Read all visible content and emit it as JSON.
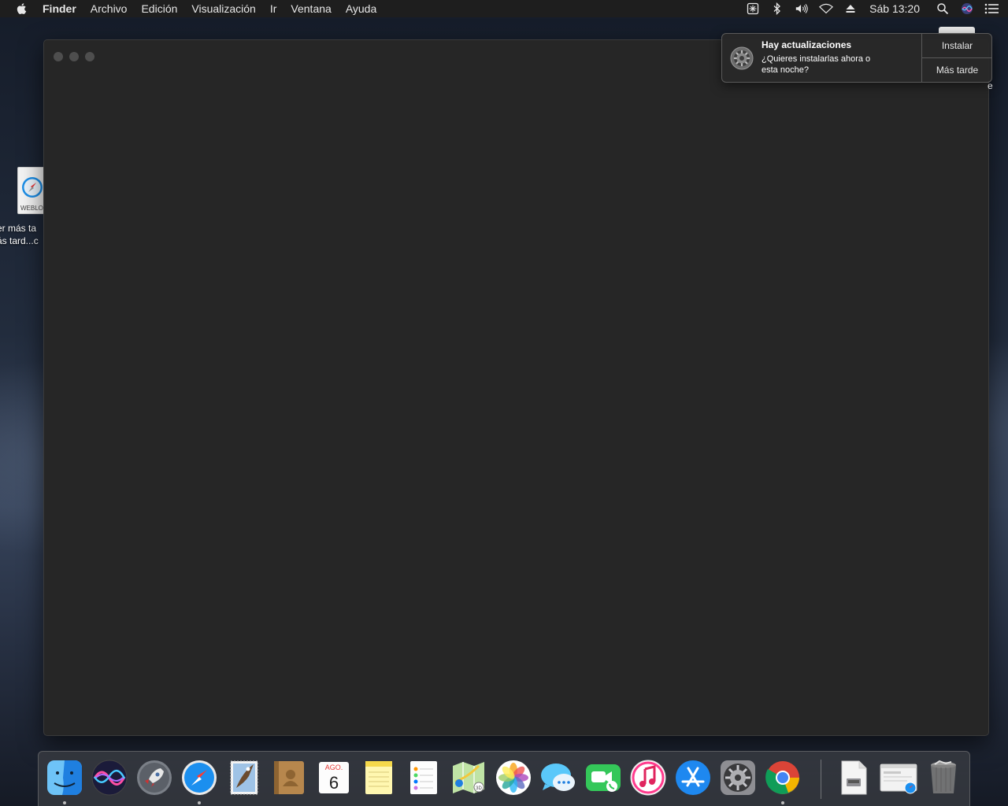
{
  "menubar": {
    "app_name": "Finder",
    "menus": [
      "Archivo",
      "Edición",
      "Visualización",
      "Ir",
      "Ventana",
      "Ayuda"
    ],
    "status_icons": [
      "screen-capture-icon",
      "bluetooth-icon",
      "volume-icon",
      "wifi-icon",
      "eject-icon"
    ],
    "clock": "Sáb 13:20"
  },
  "desktop": {
    "file_tag": "WEBLO",
    "file_label_line1": "er más ta",
    "file_label_line2": "ás tard...c"
  },
  "notification": {
    "title": "Hay actualizaciones",
    "body": "¿Quieres instalarlas ahora o esta noche?",
    "action_primary": "Instalar",
    "action_secondary": "Más tarde",
    "icon": "system-preferences-gear-icon"
  },
  "peek_char": "e",
  "dock": {
    "apps": [
      {
        "name": "finder",
        "running": true
      },
      {
        "name": "siri",
        "running": false
      },
      {
        "name": "launchpad",
        "running": false
      },
      {
        "name": "safari",
        "running": true
      },
      {
        "name": "mail",
        "running": false
      },
      {
        "name": "contacts",
        "running": false
      },
      {
        "name": "calendar",
        "running": false
      },
      {
        "name": "notes",
        "running": false
      },
      {
        "name": "reminders",
        "running": false
      },
      {
        "name": "maps",
        "running": false
      },
      {
        "name": "photos",
        "running": false
      },
      {
        "name": "messages",
        "running": false
      },
      {
        "name": "facetime",
        "running": false
      },
      {
        "name": "itunes",
        "running": false
      },
      {
        "name": "app-store",
        "running": false
      },
      {
        "name": "system-preferences",
        "running": false
      },
      {
        "name": "chrome",
        "running": true
      },
      {
        "name": "documents-stack",
        "running": false
      },
      {
        "name": "safari-window-minimized",
        "running": false
      },
      {
        "name": "trash",
        "running": false
      }
    ],
    "calendar_month": "AGO.",
    "calendar_day": "6"
  }
}
